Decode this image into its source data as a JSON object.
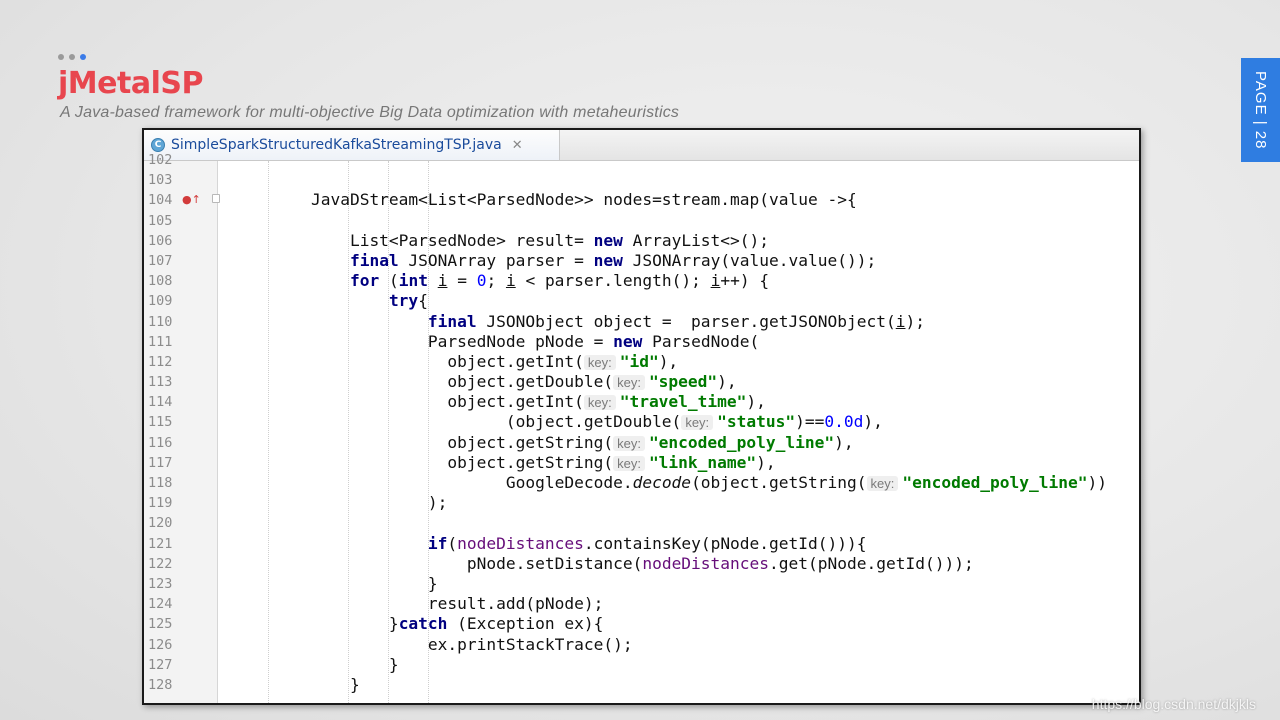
{
  "slide": {
    "brand_title": "jMetalSP",
    "brand_parts": [
      {
        "text": "jMetal",
        "color": "#e8464e"
      },
      {
        "text": "SP",
        "color": "#e8464e"
      }
    ],
    "subtitle": "A Java-based framework for multi-objective Big Data optimization with metaheuristics",
    "page_label": "PAGE | 28",
    "page_dots_active_index": 2,
    "accent_color": "#2f7de1"
  },
  "editor": {
    "tab_label": "SimpleSparkStructuredKafkaStreamingTSP.java",
    "tab_icon": "java-class-icon",
    "close_icon": "close-icon",
    "lines": [
      {
        "no": "102",
        "tokens": []
      },
      {
        "no": "103",
        "tokens": []
      },
      {
        "no": "104",
        "marker": "override-icon",
        "fold": true,
        "tokens": [
          {
            "t": "        JavaDStream<List<ParsedNode>> nodes=stream.map(value ->{"
          }
        ]
      },
      {
        "no": "105",
        "tokens": []
      },
      {
        "no": "106",
        "tokens": [
          {
            "t": "            List<ParsedNode> result= "
          },
          {
            "t": "new",
            "c": "kw"
          },
          {
            "t": " ArrayList<>();"
          }
        ]
      },
      {
        "no": "107",
        "tokens": [
          {
            "t": "            "
          },
          {
            "t": "final",
            "c": "kw"
          },
          {
            "t": " JSONArray parser = "
          },
          {
            "t": "new",
            "c": "kw"
          },
          {
            "t": " JSONArray(value.value());"
          }
        ]
      },
      {
        "no": "108",
        "tokens": [
          {
            "t": "            "
          },
          {
            "t": "for",
            "c": "kw"
          },
          {
            "t": " ("
          },
          {
            "t": "int",
            "c": "kw"
          },
          {
            "t": " "
          },
          {
            "t": "i",
            "c": "u"
          },
          {
            "t": " = "
          },
          {
            "t": "0",
            "c": "num"
          },
          {
            "t": "; "
          },
          {
            "t": "i",
            "c": "u"
          },
          {
            "t": " < parser.length(); "
          },
          {
            "t": "i",
            "c": "u"
          },
          {
            "t": "++) {"
          }
        ]
      },
      {
        "no": "109",
        "tokens": [
          {
            "t": "                "
          },
          {
            "t": "try",
            "c": "kw"
          },
          {
            "t": "{"
          }
        ]
      },
      {
        "no": "110",
        "tokens": [
          {
            "t": "                    "
          },
          {
            "t": "final",
            "c": "kw"
          },
          {
            "t": " JSONObject object =  parser.getJSONObject("
          },
          {
            "t": "i",
            "c": "u"
          },
          {
            "t": ");"
          }
        ]
      },
      {
        "no": "111",
        "tokens": [
          {
            "t": "                    ParsedNode pNode = "
          },
          {
            "t": "new",
            "c": "kw"
          },
          {
            "t": " ParsedNode("
          }
        ]
      },
      {
        "no": "112",
        "tokens": [
          {
            "t": "                      object.getInt("
          },
          {
            "t": "key:",
            "c": "hint"
          },
          {
            "t": "\"id\"",
            "c": "str"
          },
          {
            "t": "),"
          }
        ]
      },
      {
        "no": "113",
        "tokens": [
          {
            "t": "                      object.getDouble("
          },
          {
            "t": "key:",
            "c": "hint"
          },
          {
            "t": "\"speed\"",
            "c": "str"
          },
          {
            "t": "),"
          }
        ]
      },
      {
        "no": "114",
        "tokens": [
          {
            "t": "                      object.getInt("
          },
          {
            "t": "key:",
            "c": "hint"
          },
          {
            "t": "\"travel_time\"",
            "c": "str"
          },
          {
            "t": "),"
          }
        ]
      },
      {
        "no": "115",
        "tokens": [
          {
            "t": "                            (object.getDouble("
          },
          {
            "t": "key:",
            "c": "hint"
          },
          {
            "t": "\"status\"",
            "c": "str"
          },
          {
            "t": ")=="
          },
          {
            "t": "0.0d",
            "c": "num"
          },
          {
            "t": "),"
          }
        ]
      },
      {
        "no": "116",
        "tokens": [
          {
            "t": "                      object.getString("
          },
          {
            "t": "key:",
            "c": "hint"
          },
          {
            "t": "\"encoded_poly_line\"",
            "c": "str"
          },
          {
            "t": "),"
          }
        ]
      },
      {
        "no": "117",
        "tokens": [
          {
            "t": "                      object.getString("
          },
          {
            "t": "key:",
            "c": "hint"
          },
          {
            "t": "\"link_name\"",
            "c": "str"
          },
          {
            "t": "),"
          }
        ]
      },
      {
        "no": "118",
        "tokens": [
          {
            "t": "                            GoogleDecode."
          },
          {
            "t": "decode",
            "c": "ital"
          },
          {
            "t": "(object.getString("
          },
          {
            "t": "key:",
            "c": "hint"
          },
          {
            "t": "\"encoded_poly_line\"",
            "c": "str"
          },
          {
            "t": "))"
          }
        ]
      },
      {
        "no": "119",
        "tokens": [
          {
            "t": "                    );"
          }
        ]
      },
      {
        "no": "120",
        "tokens": []
      },
      {
        "no": "121",
        "tokens": [
          {
            "t": "                    "
          },
          {
            "t": "if",
            "c": "kw"
          },
          {
            "t": "("
          },
          {
            "t": "nodeDistances",
            "c": "field"
          },
          {
            "t": ".containsKey(pNode.getId())){"
          }
        ]
      },
      {
        "no": "122",
        "tokens": [
          {
            "t": "                        pNode.setDistance("
          },
          {
            "t": "nodeDistances",
            "c": "field"
          },
          {
            "t": ".get(pNode.getId()));"
          }
        ]
      },
      {
        "no": "123",
        "tokens": [
          {
            "t": "                    }"
          }
        ]
      },
      {
        "no": "124",
        "tokens": [
          {
            "t": "                    result.add(pNode);"
          }
        ]
      },
      {
        "no": "125",
        "tokens": [
          {
            "t": "                }"
          },
          {
            "t": "catch",
            "c": "kw"
          },
          {
            "t": " (Exception ex){"
          }
        ]
      },
      {
        "no": "126",
        "tokens": [
          {
            "t": "                    ex.printStackTrace();"
          }
        ]
      },
      {
        "no": "127",
        "tokens": [
          {
            "t": "                }"
          }
        ]
      },
      {
        "no": "128",
        "tokens": [
          {
            "t": "            }"
          }
        ]
      }
    ]
  },
  "watermark": "https://blog.csdn.net/dkjkls"
}
